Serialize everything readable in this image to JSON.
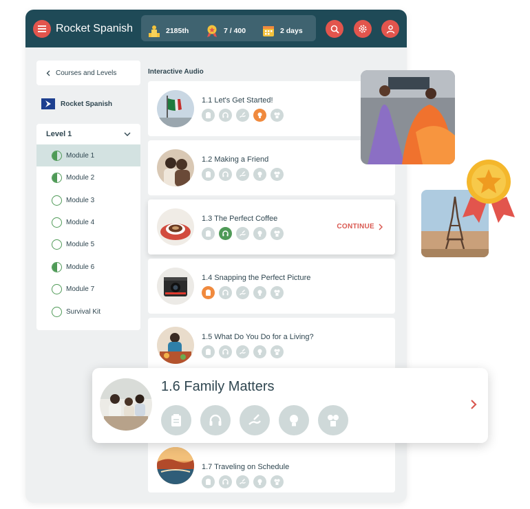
{
  "header": {
    "brand": "Rocket Spanish",
    "rank": "2185th",
    "points": "7 / 400",
    "streak": "2 days"
  },
  "sidebar": {
    "back_label": "Courses and Levels",
    "course_name": "Rocket Spanish",
    "level_label": "Level 1",
    "modules": [
      {
        "label": "Module 1",
        "progress": "half",
        "active": true
      },
      {
        "label": "Module 2",
        "progress": "half",
        "active": false
      },
      {
        "label": "Module 3",
        "progress": "none",
        "active": false
      },
      {
        "label": "Module 4",
        "progress": "none",
        "active": false
      },
      {
        "label": "Module 5",
        "progress": "none",
        "active": false
      },
      {
        "label": "Module 6",
        "progress": "half",
        "active": false
      },
      {
        "label": "Module 7",
        "progress": "none",
        "active": false
      },
      {
        "label": "Survival Kit",
        "progress": "none",
        "active": false
      }
    ]
  },
  "main": {
    "section_label": "Interactive Audio",
    "continue_label": "CONTINUE",
    "lessons": [
      {
        "title": "1.1 Let's Get Started!"
      },
      {
        "title": "1.2 Making a Friend"
      },
      {
        "title": "1.3 The Perfect Coffee"
      },
      {
        "title": "1.4 Snapping the Perfect Picture"
      },
      {
        "title": "1.5 What Do You Do for a Living?"
      },
      {
        "title": "1.7 Traveling on Schedule"
      }
    ],
    "featured": {
      "title": "1.6 Family Matters"
    }
  },
  "colors": {
    "header_bg": "#1f4a57",
    "accent_red": "#e2554d",
    "progress_green": "#4f9a57",
    "icon_orange": "#f08a3e",
    "icon_inactive": "#cfd9d9"
  },
  "icons": [
    "menu-icon",
    "rank-icon",
    "medal-icon",
    "calendar-icon",
    "search-icon",
    "gear-icon",
    "user-icon",
    "chevron-left-icon",
    "chevron-down-icon",
    "chevron-right-icon",
    "notebook-icon",
    "headphones-icon",
    "writing-icon",
    "lightbulb-icon",
    "puzzle-icon"
  ]
}
